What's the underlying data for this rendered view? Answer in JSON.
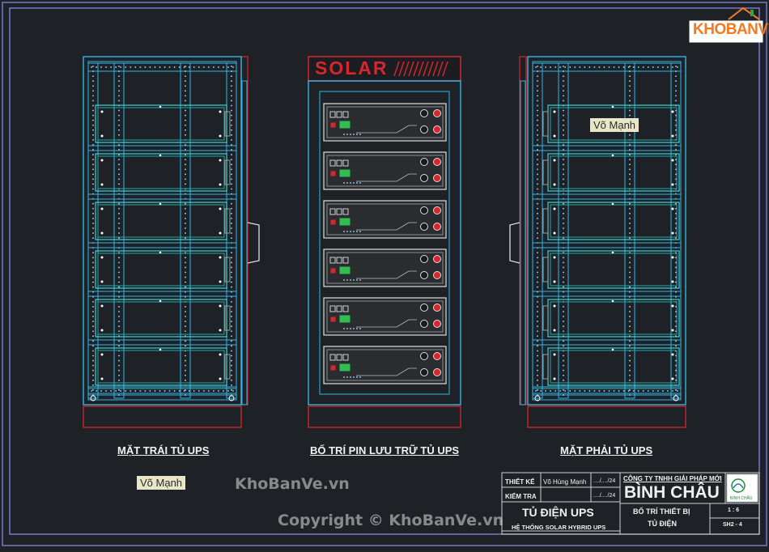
{
  "logo": {
    "text": "KHOBANVE",
    "colors": {
      "orange": "#f47a20",
      "green": "#3aa53a"
    }
  },
  "views": {
    "left_label": "MẶT TRÁI TỦ UPS",
    "center_label": "BỐ TRÍ PIN LƯU TRỮ TỦ UPS",
    "right_label": "MẶT PHẢI TỦ UPS",
    "solar_banner": "SOLAR",
    "battery_count": 6,
    "rack_rows": 6
  },
  "tags": {
    "left": "Võ Mạnh",
    "right": "Võ Mạnh"
  },
  "watermark": {
    "site": "KhoBanVe.vn",
    "copyright": "Copyright © KhoBanVe.vn"
  },
  "title_block": {
    "designed_label": "THIẾT KẾ",
    "designer": "Võ Hùng Mạnh",
    "date1": "..../..../24",
    "checked_label": "KIỂM TRA",
    "date2": "..../..../24",
    "company_line": "CÔNG TY TNHH GIẢI PHÁP MỚI",
    "company_name": "BÌNH CHÂU",
    "company_logo_text": "BÌNH CHÂU",
    "project_title": "TỦ ĐIỆN UPS",
    "project_subtitle": "HỆ THỐNG SOLAR HYBRID UPS",
    "drawing_title_1": "BỐ TRÍ THIẾT BỊ",
    "drawing_title_2": "TỦ ĐIỆN",
    "scale": "1 : 6",
    "sheet": "SH2 - 4"
  },
  "colors": {
    "background": "#1e2227",
    "border": "#7a78c8",
    "frame_cyan": "#2fb6e6",
    "tray_cyan": "#3fd3cf",
    "accent_red": "#d8262d",
    "battery_face": "#2a2c30"
  }
}
